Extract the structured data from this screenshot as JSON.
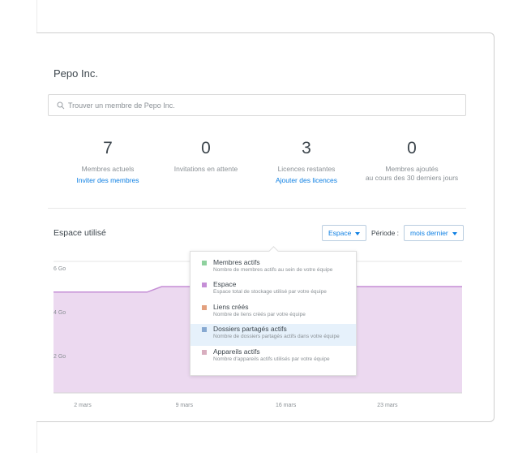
{
  "team": {
    "name": "Pepo Inc."
  },
  "search": {
    "placeholder": "Trouver un membre de Pepo Inc."
  },
  "stats": [
    {
      "value": "7",
      "label": "Membres actuels",
      "link": "Inviter des membres"
    },
    {
      "value": "0",
      "label": "Invitations en attente"
    },
    {
      "value": "3",
      "label": "Licences restantes",
      "link": "Ajouter des licences"
    },
    {
      "value": "0",
      "label_line1": "Membres ajoutés",
      "label_line2": "au cours des 30 derniers jours"
    }
  ],
  "usage": {
    "title": "Espace utilisé",
    "metric_dropdown": "Espace",
    "period_label": "Période :",
    "period_dropdown": "mois dernier"
  },
  "metric_menu": [
    {
      "title": "Membres actifs",
      "desc": "Nombre de membres actifs au sein de votre équipe",
      "color": "#8fd19e"
    },
    {
      "title": "Espace",
      "desc": "Espace total de stockage utilisé par votre équipe",
      "color": "#c58ed6"
    },
    {
      "title": "Liens créés",
      "desc": "Nombre de liens créés par votre équipe",
      "color": "#e3a07e"
    },
    {
      "title": "Dossiers partagés actifs",
      "desc": "Nombre de dossiers partagés actifs dans votre équipe",
      "color": "#87a9d1",
      "highlighted": true
    },
    {
      "title": "Appareils actifs",
      "desc": "Nombre d'appareils actifs utilisés par votre équipe",
      "color": "#d8aebf"
    }
  ],
  "chart_data": {
    "type": "area",
    "y_tick_labels": [
      "2 Go",
      "4 Go",
      "6 Go"
    ],
    "x_tick_labels": [
      "2 mars",
      "9 mars",
      "16 mars",
      "23 mars"
    ],
    "ylim": [
      0,
      6
    ],
    "x": [
      "2 mars",
      "7 mars",
      "8 mars",
      "31 mars"
    ],
    "series": [
      {
        "values": [
          4.6,
          4.6,
          4.85,
          4.85
        ],
        "color": "#c58ed6"
      }
    ],
    "grid": true
  }
}
